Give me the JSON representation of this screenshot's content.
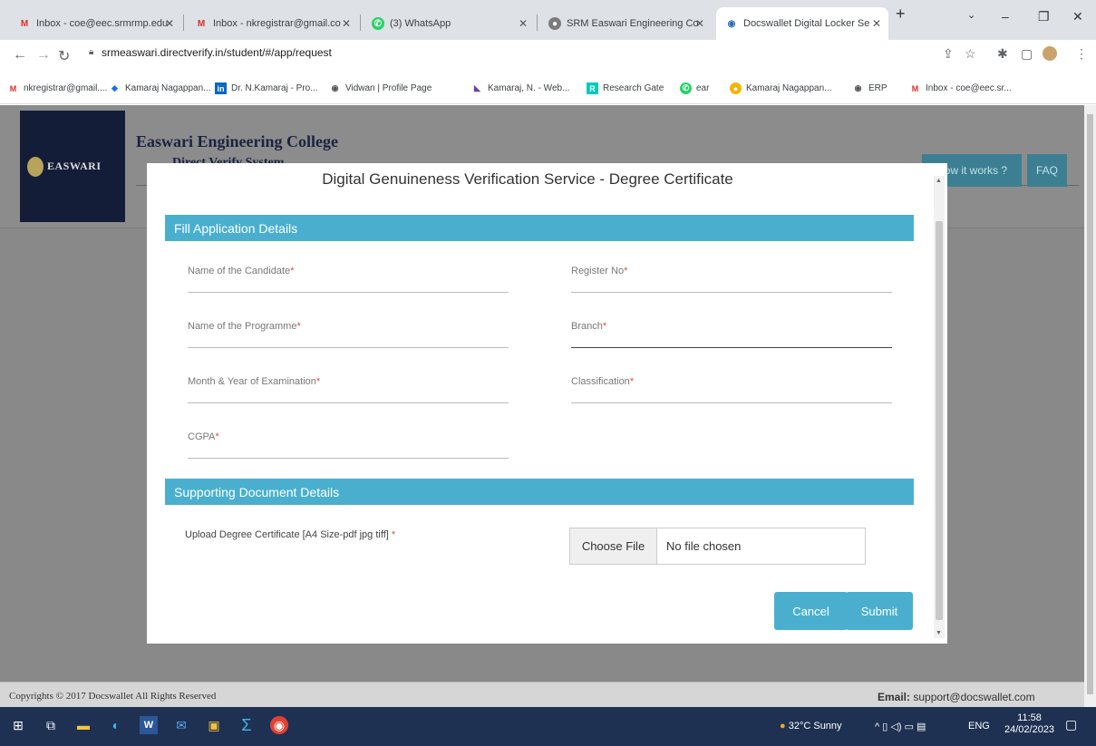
{
  "browser": {
    "tabs": [
      {
        "label": "Inbox - coe@eec.srmrmp.edu",
        "icon": "gmail-icon"
      },
      {
        "label": "Inbox - nkregistrar@gmail.co",
        "icon": "gmail-icon"
      },
      {
        "label": "(3) WhatsApp",
        "icon": "whatsapp-icon"
      },
      {
        "label": "SRM Easwari Engineering Co",
        "icon": "college-icon"
      },
      {
        "label": "Docswallet Digital Locker Se",
        "icon": "docswallet-icon"
      }
    ],
    "url": "srmeaswari.directverify.in/student/#/app/request",
    "bookmarks": [
      "nkregistrar@gmail....",
      "Kamaraj Nagappan...",
      "Dr. N.Kamaraj - Pro...",
      "Vidwan | Profile Page",
      "Kamaraj, N. - Web...",
      "Research Gate",
      "ear",
      "Kamaraj Nagappan...",
      "ERP",
      "Inbox - coe@eec.sr..."
    ]
  },
  "header": {
    "logo_text": "EASWARI",
    "college_name": "Easwari Engineering College",
    "system_name": "Direct Verify System",
    "how_it_works": "How it works ?",
    "faq": "FAQ"
  },
  "modal": {
    "title": "Digital Genuineness Verification Service - Degree Certificate",
    "section_application": "Fill Application Details",
    "fields": {
      "candidate_name": "Name of the Candidate",
      "register_no": "Register No",
      "programme": "Name of the Programme",
      "branch": "Branch",
      "exam_month_year": "Month & Year of Examination",
      "classification": "Classification",
      "cgpa": "CGPA"
    },
    "required_mark": "*",
    "section_documents": "Supporting Document Details",
    "upload_label": "Upload Degree Certificate [A4 Size-pdf jpg tiff]",
    "choose_file": "Choose File",
    "file_status": "No file chosen",
    "cancel": "Cancel",
    "submit": "Submit"
  },
  "footer": {
    "copyright": "Copyrights © 2017 Docswallet All Rights Reserved",
    "email_label": "Email:",
    "email": "support@docswallet.com"
  },
  "taskbar": {
    "weather": "32°C Sunny",
    "lang": "ENG",
    "time": "11:58",
    "date": "24/02/2023"
  },
  "colors": {
    "accent": "#4aafcf",
    "overlay": "#898989",
    "header_button": "#3d7f92",
    "taskbar": "#1f3152"
  }
}
